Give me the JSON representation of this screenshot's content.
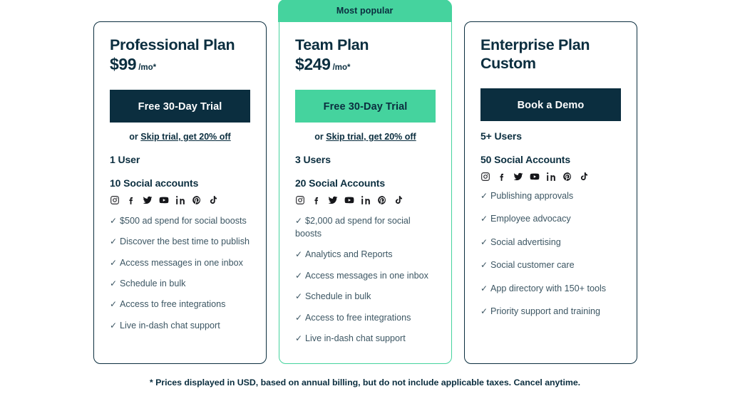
{
  "footnote": "* Prices displayed in USD, based on annual billing, but do not include applicable taxes. Cancel anytime.",
  "colors": {
    "navy": "#0B2E3F",
    "green": "#45D39E",
    "body_text": "#3C5663",
    "icon": "#15161A"
  },
  "social_icons": [
    {
      "name": "instagram-icon",
      "label": "Instagram"
    },
    {
      "name": "facebook-icon",
      "label": "Facebook"
    },
    {
      "name": "twitter-icon",
      "label": "Twitter"
    },
    {
      "name": "youtube-icon",
      "label": "YouTube"
    },
    {
      "name": "linkedin-icon",
      "label": "LinkedIn"
    },
    {
      "name": "pinterest-icon",
      "label": "Pinterest"
    },
    {
      "name": "tiktok-icon",
      "label": "TikTok"
    }
  ],
  "check_glyph": "✓",
  "plans": [
    {
      "id": "professional",
      "badge": null,
      "name": "Professional Plan",
      "price": "$99",
      "price_suffix": "/mo*",
      "cta_label": "Free 30-Day Trial",
      "cta_style": "dark",
      "skip_prefix": "or ",
      "skip_link": "Skip trial, get 20% off",
      "users": "1 User",
      "accounts": "10 Social accounts",
      "features": [
        "$500 ad spend for social boosts",
        "Discover the best time to publish",
        "Access messages in one inbox",
        "Schedule in bulk",
        "Access to free integrations",
        "Live in-dash chat support"
      ]
    },
    {
      "id": "team",
      "badge": "Most popular",
      "name": "Team Plan",
      "price": "$249",
      "price_suffix": "/mo*",
      "cta_label": "Free 30-Day Trial",
      "cta_style": "green",
      "skip_prefix": "or ",
      "skip_link": "Skip trial, get 20% off",
      "users": "3 Users",
      "accounts": "20 Social Accounts",
      "features": [
        "$2,000 ad spend for social boosts",
        "Analytics and Reports",
        "Access messages in one inbox",
        "Schedule in bulk",
        "Access to free integrations",
        "Live in-dash chat support"
      ]
    },
    {
      "id": "enterprise",
      "badge": null,
      "name": "Enterprise Plan",
      "price": "Custom",
      "price_suffix": "",
      "cta_label": "Book a Demo",
      "cta_style": "dark",
      "skip_prefix": "",
      "skip_link": "",
      "users": "5+ Users",
      "accounts": "50 Social Accounts",
      "features": [
        "Publishing approvals",
        "Employee advocacy",
        "Social advertising",
        "Social customer care",
        "App directory with 150+ tools",
        "Priority support and training"
      ]
    }
  ]
}
